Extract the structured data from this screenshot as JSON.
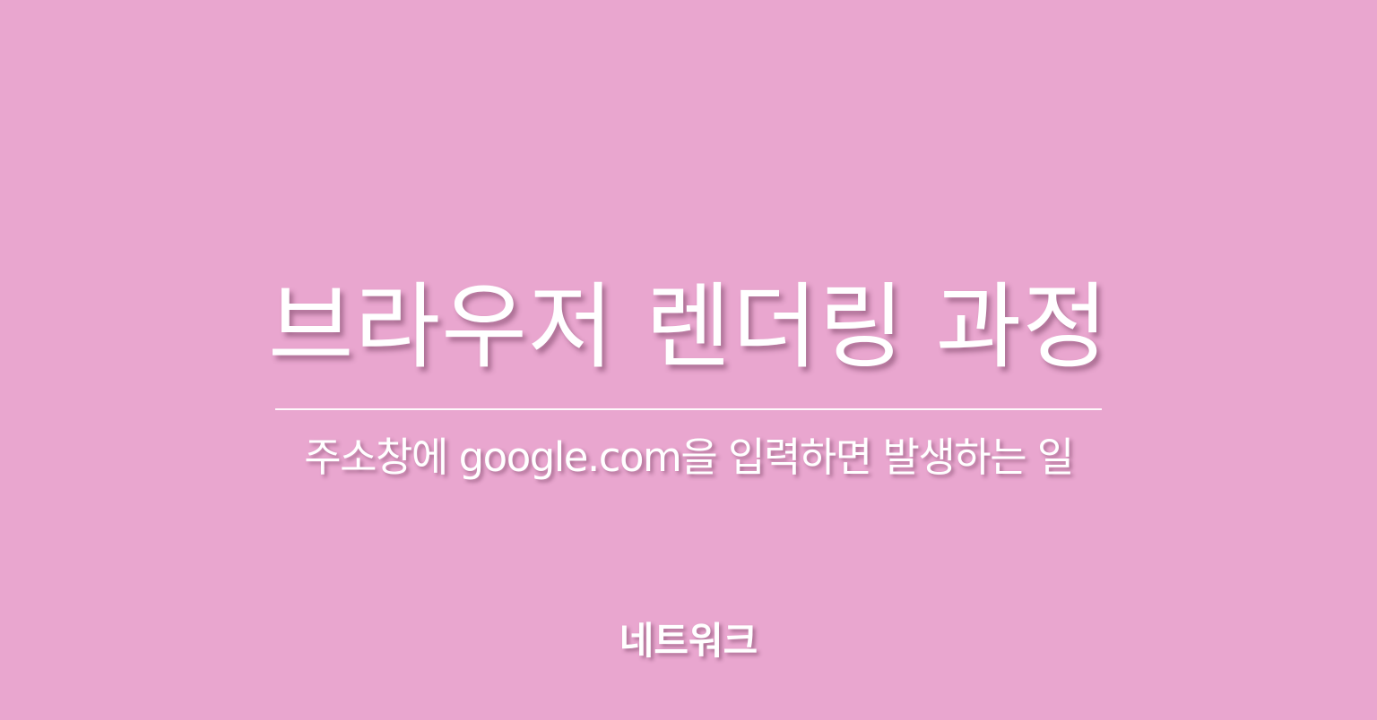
{
  "cover": {
    "background_color": "#e9a6cf",
    "title": "브라우저 렌더링 과정",
    "subtitle": "주소창에 google.com을 입력하면 발생하는 일",
    "category": "네트워크"
  }
}
